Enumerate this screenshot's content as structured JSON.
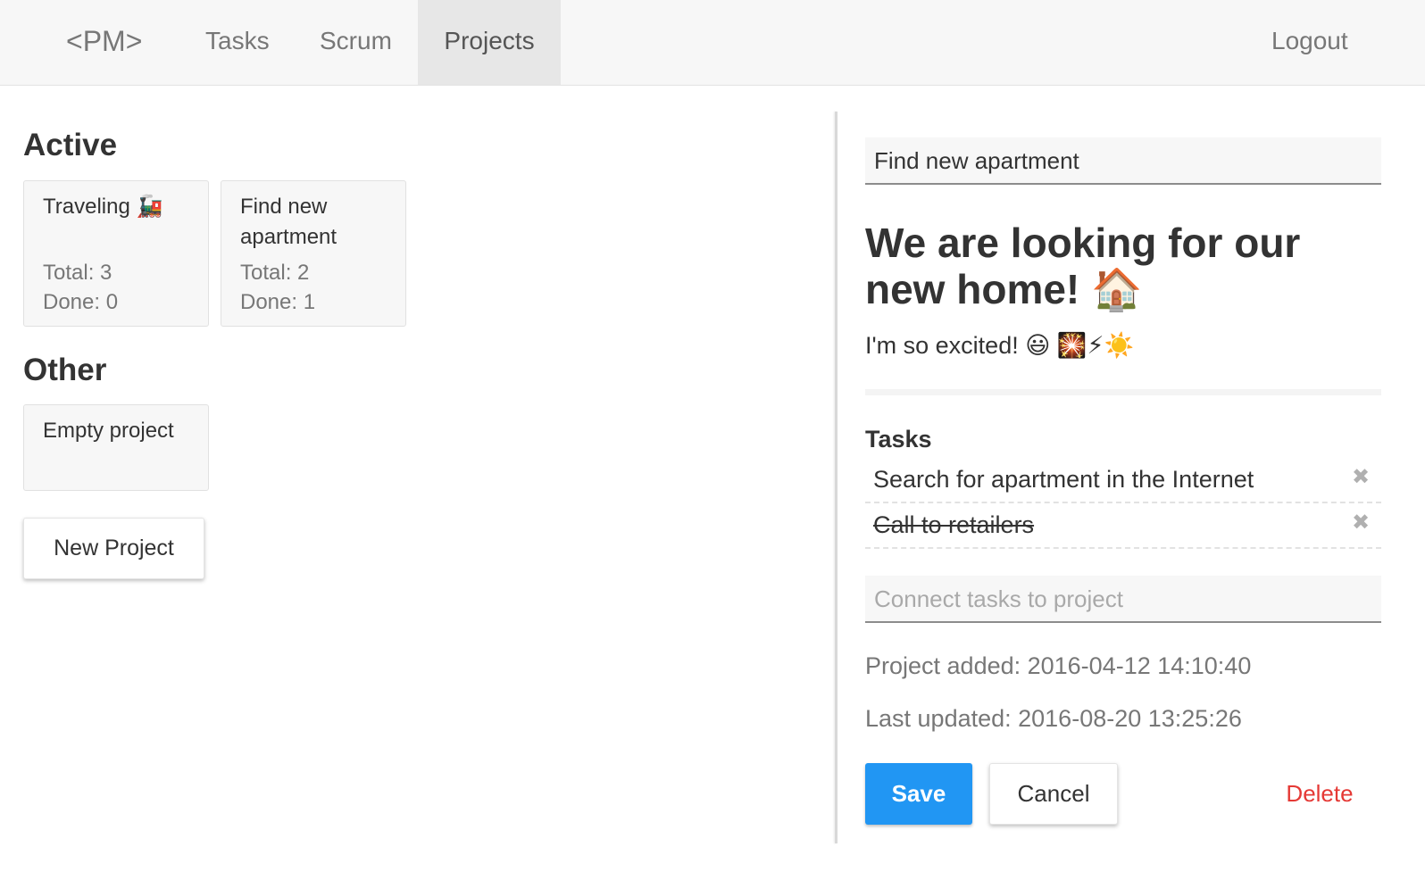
{
  "nav": {
    "brand": "<PM>",
    "items": [
      {
        "label": "Tasks"
      },
      {
        "label": "Scrum"
      },
      {
        "label": "Projects",
        "active": true
      }
    ],
    "logout": "Logout"
  },
  "sections": {
    "active": {
      "title": "Active",
      "cards": [
        {
          "name": "Traveling 🚂",
          "total": "Total: 3",
          "done": "Done: 0"
        },
        {
          "name": "Find new apartment",
          "total": "Total: 2",
          "done": "Done: 1"
        }
      ]
    },
    "other": {
      "title": "Other",
      "cards": [
        {
          "name": "Empty project"
        }
      ]
    }
  },
  "new_project_label": "New Project",
  "detail": {
    "title_value": "Find new apartment",
    "heading": "We are looking for our new home! 🏠",
    "text": "I'm so excited! 😃 🎇⚡☀️",
    "tasks_label": "Tasks",
    "tasks": [
      {
        "name": "Search for apartment in the Internet",
        "done": false
      },
      {
        "name": "Call to retailers",
        "done": true
      }
    ],
    "remove_icon": "✖",
    "connect_placeholder": "Connect tasks to project",
    "added": "Project added: 2016-04-12 14:10:40",
    "updated": "Last updated: 2016-08-20 13:25:26",
    "save_label": "Save",
    "cancel_label": "Cancel",
    "delete_label": "Delete"
  },
  "colors": {
    "primary": "#2196f3",
    "danger": "#e53935",
    "navbar_bg": "#f7f7f7",
    "nav_active_bg": "#e7e7e7"
  }
}
